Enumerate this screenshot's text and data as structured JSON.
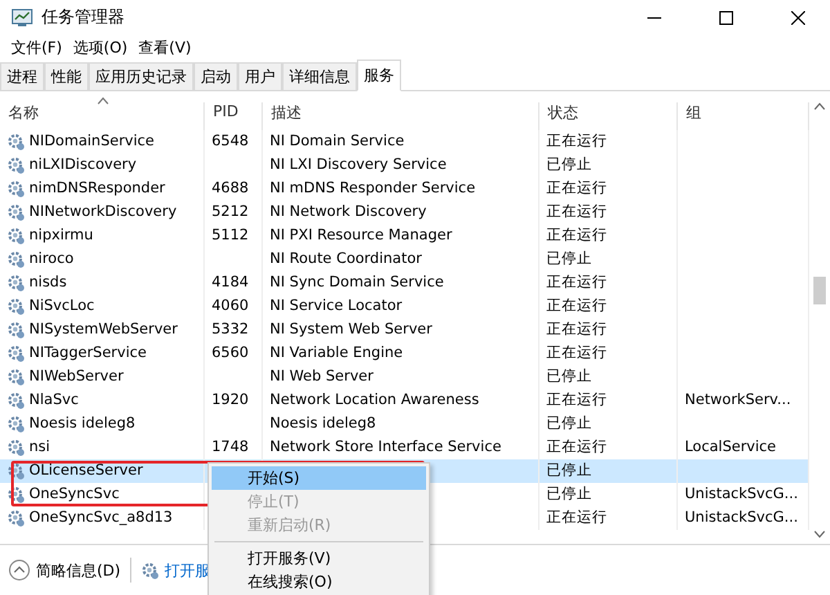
{
  "window": {
    "title": "任务管理器"
  },
  "menu": [
    "文件(F)",
    "选项(O)",
    "查看(V)"
  ],
  "tabs": [
    {
      "label": "进程",
      "selected": false
    },
    {
      "label": "性能",
      "selected": false
    },
    {
      "label": "应用历史记录",
      "selected": false
    },
    {
      "label": "启动",
      "selected": false
    },
    {
      "label": "用户",
      "selected": false
    },
    {
      "label": "详细信息",
      "selected": false
    },
    {
      "label": "服务",
      "selected": true
    }
  ],
  "table": {
    "columns": [
      "名称",
      "PID",
      "描述",
      "状态",
      "组"
    ],
    "rows": [
      {
        "name": "NIDomainService",
        "pid": "6548",
        "description": "NI Domain Service",
        "status": "正在运行",
        "selected": false
      },
      {
        "name": "niLXIDiscovery",
        "description": "NI LXI Discovery Service",
        "status": "已停止",
        "selected": false
      },
      {
        "name": "nimDNSResponder",
        "pid": "4688",
        "description": "NI mDNS Responder Service",
        "status": "正在运行",
        "selected": false
      },
      {
        "name": "NINetworkDiscovery",
        "pid": "5212",
        "description": "NI Network Discovery",
        "status": "正在运行",
        "selected": false
      },
      {
        "name": "nipxirmu",
        "pid": "5112",
        "description": "NI PXI Resource Manager",
        "status": "正在运行",
        "selected": false
      },
      {
        "name": "niroco",
        "description": "NI Route Coordinator",
        "status": "已停止",
        "selected": false
      },
      {
        "name": "nisds",
        "pid": "4184",
        "description": "NI Sync Domain Service",
        "status": "正在运行",
        "selected": false
      },
      {
        "name": "NiSvcLoc",
        "pid": "4060",
        "description": "NI Service Locator",
        "status": "正在运行",
        "selected": false
      },
      {
        "name": "NISystemWebServer",
        "pid": "5332",
        "description": "NI System Web Server",
        "status": "正在运行",
        "selected": false
      },
      {
        "name": "NITaggerService",
        "pid": "6560",
        "description": "NI Variable Engine",
        "status": "正在运行",
        "selected": false
      },
      {
        "name": "NIWebServer",
        "description": "NI Web Server",
        "status": "已停止",
        "selected": false
      },
      {
        "name": "NlaSvc",
        "pid": "1920",
        "description": "Network Location Awareness",
        "status": "正在运行",
        "group": "NetworkServ...",
        "selected": false
      },
      {
        "name": "Noesis ideleg8",
        "description": "Noesis ideleg8",
        "status": "已停止",
        "selected": false
      },
      {
        "name": "nsi",
        "pid": "1748",
        "description": "Network Store Interface Service",
        "status": "正在运行",
        "group": "LocalService",
        "selected": false
      },
      {
        "name": "OLicenseServer",
        "status": "已停止",
        "selected": true
      },
      {
        "name": "OneSyncSvc",
        "status": "已停止",
        "group": "UnistackSvcG...",
        "selected": false
      },
      {
        "name": "OneSyncSvc_a8d13",
        "status": "正在运行",
        "group": "UnistackSvcG...",
        "selected": false
      }
    ]
  },
  "footer": {
    "details": "简略信息(D)",
    "open_services": "打开服"
  },
  "context_menu": [
    {
      "label": "开始(S)",
      "disabled": false,
      "selected": true
    },
    {
      "label": "停止(T)",
      "disabled": true,
      "selected": false
    },
    {
      "label": "重新启动(R)",
      "disabled": true,
      "selected": false
    },
    {
      "kind": "separator"
    },
    {
      "label": "打开服务(V)",
      "disabled": false,
      "selected": false
    },
    {
      "label": "在线搜索(O)",
      "disabled": false,
      "selected": false
    }
  ]
}
